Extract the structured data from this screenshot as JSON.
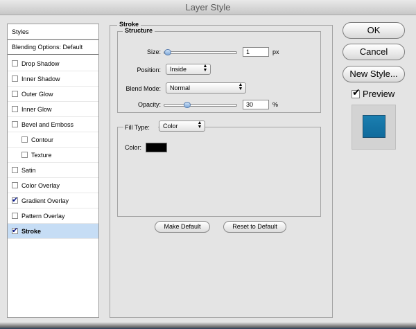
{
  "window": {
    "title": "Layer Style"
  },
  "sidebar": {
    "header": "Styles",
    "blending": "Blending Options: Default",
    "items": [
      {
        "label": "Drop Shadow",
        "checked": false,
        "indent": false,
        "selected": false,
        "bold": false
      },
      {
        "label": "Inner Shadow",
        "checked": false,
        "indent": false,
        "selected": false,
        "bold": false
      },
      {
        "label": "Outer Glow",
        "checked": false,
        "indent": false,
        "selected": false,
        "bold": false
      },
      {
        "label": "Inner Glow",
        "checked": false,
        "indent": false,
        "selected": false,
        "bold": false
      },
      {
        "label": "Bevel and Emboss",
        "checked": false,
        "indent": false,
        "selected": false,
        "bold": false
      },
      {
        "label": "Contour",
        "checked": false,
        "indent": true,
        "selected": false,
        "bold": false
      },
      {
        "label": "Texture",
        "checked": false,
        "indent": true,
        "selected": false,
        "bold": false
      },
      {
        "label": "Satin",
        "checked": false,
        "indent": false,
        "selected": false,
        "bold": false
      },
      {
        "label": "Color Overlay",
        "checked": false,
        "indent": false,
        "selected": false,
        "bold": false
      },
      {
        "label": "Gradient Overlay",
        "checked": true,
        "indent": false,
        "selected": false,
        "bold": false
      },
      {
        "label": "Pattern Overlay",
        "checked": false,
        "indent": false,
        "selected": false,
        "bold": false
      },
      {
        "label": "Stroke",
        "checked": true,
        "indent": false,
        "selected": true,
        "bold": true
      }
    ]
  },
  "stroke": {
    "title": "Stroke",
    "structure": {
      "title": "Structure",
      "size_label": "Size:",
      "size_value": "1",
      "size_unit": "px",
      "size_level": 0.01,
      "position_label": "Position:",
      "position_value": "Inside",
      "blend_label": "Blend Mode:",
      "blend_value": "Normal",
      "opacity_label": "Opacity:",
      "opacity_value": "30",
      "opacity_unit": "%",
      "opacity_level": 0.3
    },
    "fill": {
      "type_label": "Fill Type:",
      "type_value": "Color",
      "color_label": "Color:",
      "color": "#000000"
    },
    "make_default": "Make Default",
    "reset_default": "Reset to Default"
  },
  "actions": {
    "ok": "OK",
    "cancel": "Cancel",
    "new_style": "New Style...",
    "preview_label": "Preview",
    "preview_checked": true,
    "preview_color": "#1b7fb0"
  }
}
